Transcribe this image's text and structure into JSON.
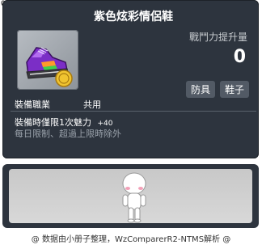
{
  "item_id": "01072909",
  "item_name": "紫色炫彩情侶鞋",
  "stat": {
    "label": "戰鬥力提升量",
    "value": "0"
  },
  "tags": [
    "防具",
    "鞋子"
  ],
  "job": {
    "label": "裝備職業",
    "value": "共用"
  },
  "equip_effect": {
    "text": "裝備時僅限1次魅力",
    "bonus": "+40"
  },
  "limit_text": "每日限制、超過上限時除外",
  "footer": "@ 数据由小册子整理，WzComparerR2-NTMS解析 @",
  "icons": [
    "purple-sneaker-icon",
    "gold-coin-icon",
    "character-avatar"
  ],
  "colors": {
    "panel": "#2d343e",
    "tag": "#525a65",
    "muted_text": "#9aa2ab"
  }
}
